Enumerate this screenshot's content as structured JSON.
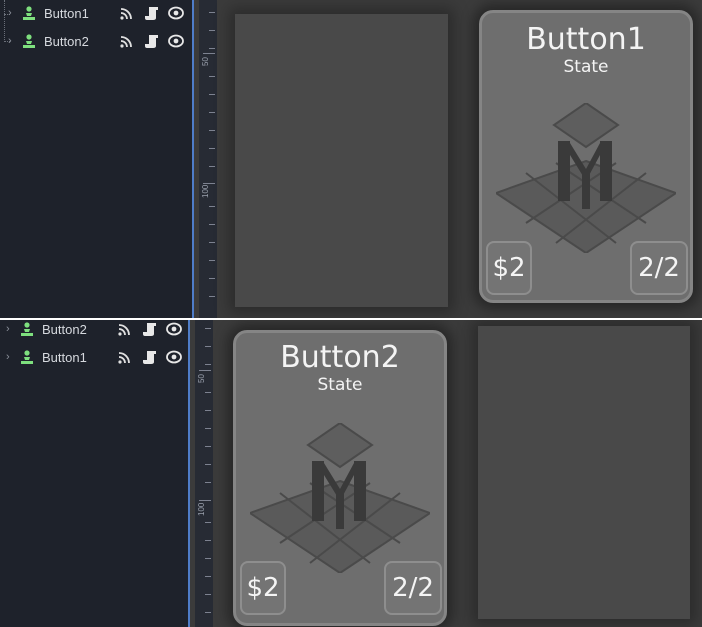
{
  "panels": [
    {
      "tree": [
        {
          "label": "Button1"
        },
        {
          "label": "Button2"
        }
      ],
      "ruler_labels": [
        "50",
        "100"
      ],
      "card": {
        "title": "Button1",
        "state": "State",
        "cost": "$2",
        "stats": "2/2"
      }
    },
    {
      "tree": [
        {
          "label": "Button2"
        },
        {
          "label": "Button1"
        }
      ],
      "ruler_labels": [
        "50",
        "100"
      ],
      "card": {
        "title": "Button2",
        "state": "State",
        "cost": "$2",
        "stats": "2/2"
      }
    }
  ],
  "icons": {
    "expand": "chevron-right-icon",
    "node": "control-node-icon",
    "signals": "signal-icon",
    "script": "script-icon",
    "visibility": "eye-icon"
  },
  "colors": {
    "node_icon": "#7ee07e",
    "tree_bg": "#1e222b",
    "ruler_line": "#4f7dc8",
    "card_bg": "#6e6e6e",
    "slot_bg": "#494949",
    "viewport_bg": "#3b3b3b"
  }
}
